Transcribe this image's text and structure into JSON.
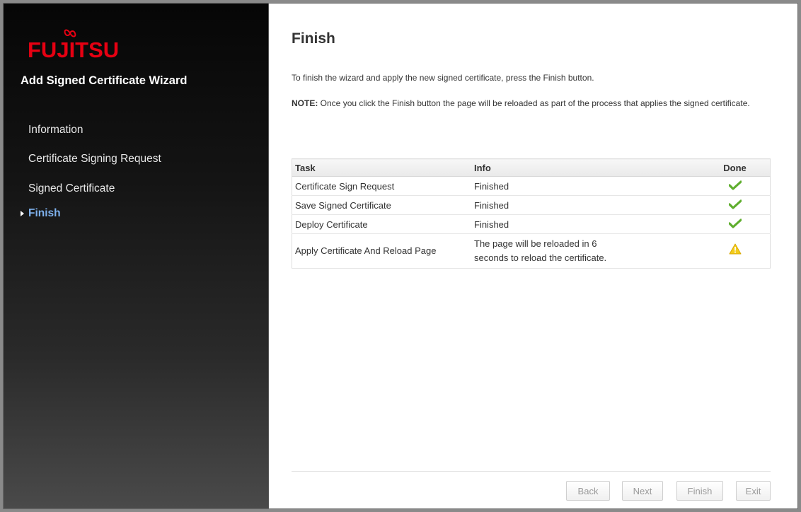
{
  "brand": {
    "logo_text": "FUJITSU",
    "color": "#e60012"
  },
  "sidebar": {
    "wizard_title": "Add Signed Certificate Wizard",
    "steps": [
      {
        "label": "Information",
        "active": false
      },
      {
        "label": "Certificate Signing Request",
        "active": false
      },
      {
        "label": "Signed Certificate",
        "active": false
      },
      {
        "label": "Finish",
        "active": true
      }
    ],
    "active_color": "#7fb2ee"
  },
  "main": {
    "title": "Finish",
    "intro": "To finish the wizard and apply the new signed certificate, press the Finish button.",
    "note_label": "NOTE:",
    "note_text": " Once you click the Finish button the page will be reloaded as part of the process that applies the signed certificate.",
    "table": {
      "headers": {
        "task": "Task",
        "info": "Info",
        "done": "Done"
      },
      "rows": [
        {
          "task": "Certificate Sign Request",
          "info": "Finished",
          "status_icon": "checkmark-icon"
        },
        {
          "task": "Save Signed Certificate",
          "info": "Finished",
          "status_icon": "checkmark-icon"
        },
        {
          "task": "Deploy Certificate",
          "info": "Finished",
          "status_icon": "checkmark-icon"
        },
        {
          "task": "Apply Certificate And Reload Page",
          "info_line1": "The page will be reloaded in 6",
          "info_line2": "seconds to reload the certificate.",
          "status_icon": "warning-icon"
        }
      ]
    }
  },
  "footer": {
    "buttons": {
      "back": "Back",
      "next": "Next",
      "finish": "Finish",
      "exit": "Exit"
    },
    "disabled": true
  }
}
